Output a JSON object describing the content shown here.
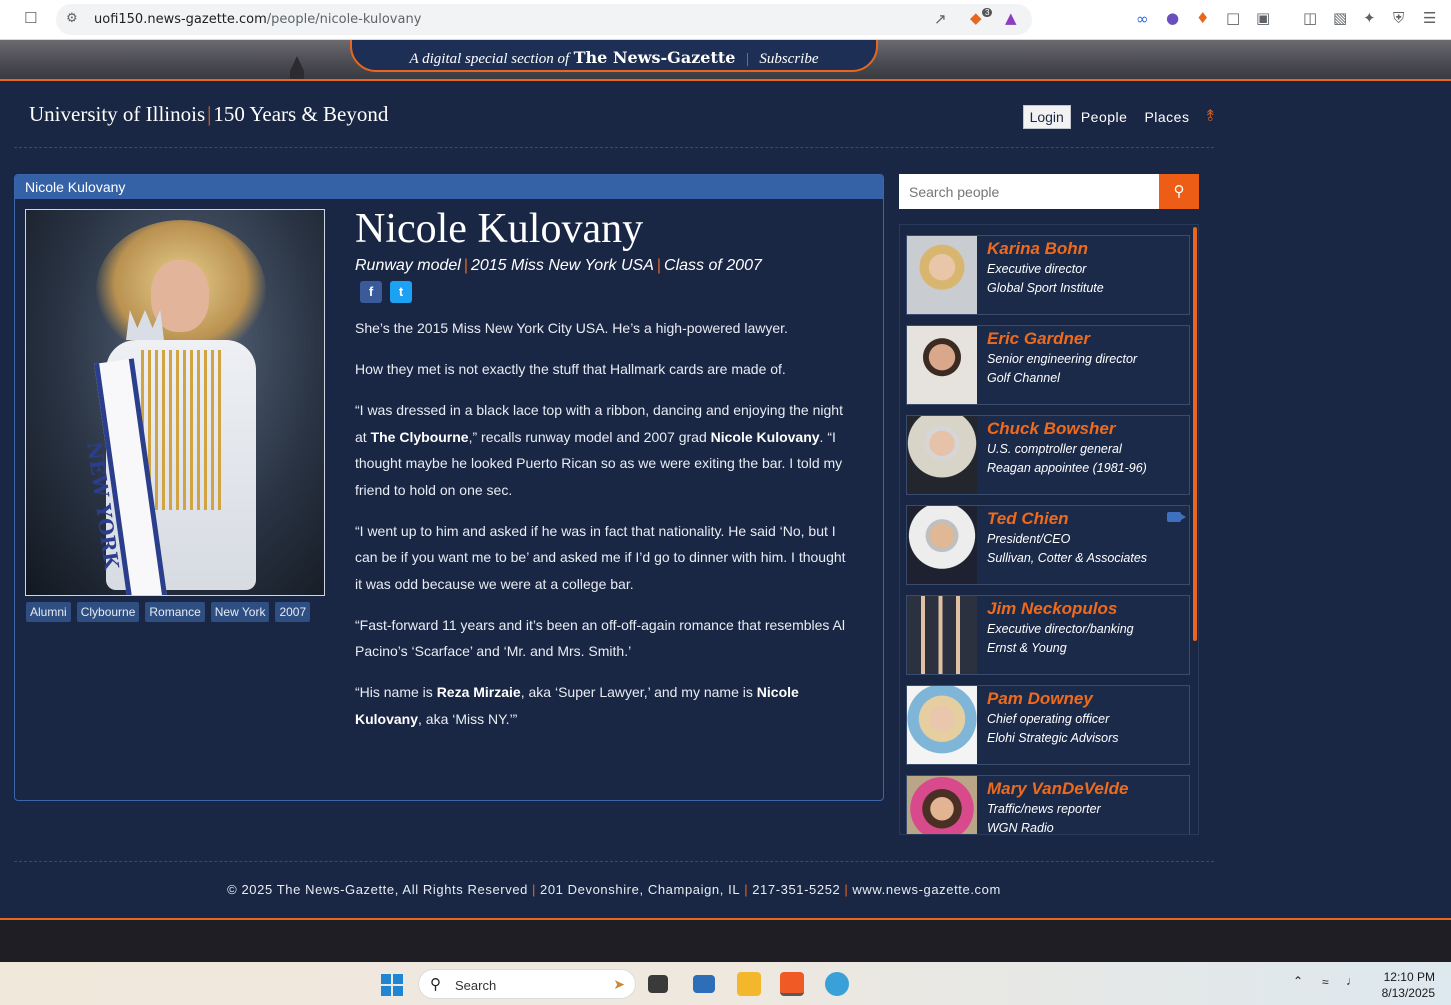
{
  "browser": {
    "url_host": "uofi150.news-gazette.com",
    "url_path": "/people/nicole-kulovany",
    "shields_badge": "3"
  },
  "banner": {
    "prefix": "A digital special section of",
    "paper": "The News-Gazette",
    "subscribe": "Subscribe"
  },
  "header": {
    "title_left": "University of Illinois",
    "title_right": "150 Years & Beyond",
    "nav": {
      "login": "Login",
      "people": "People",
      "places": "Places"
    }
  },
  "panel": {
    "heading": "Nicole Kulovany",
    "name": "Nicole Kulovany",
    "subtitle": [
      "Runway model",
      "2015 Miss New York USA",
      "Class of 2007"
    ],
    "social": {
      "facebook": "f",
      "twitter": "t"
    },
    "sash_text": "NEW YORK",
    "tags": [
      "Alumni",
      "Clybourne",
      "Romance",
      "New York",
      "2007"
    ],
    "article": {
      "p1": "She’s the 2015 Miss New York City USA. He’s a high-powered lawyer.",
      "p2": "How they met is not exactly the stuff that Hallmark cards are made of.",
      "p3a": "“I was dressed in a black lace top with a ribbon, dancing and enjoying the night at ",
      "p3b": "The Clybourne",
      "p3c": ",” recalls runway model and 2007 grad ",
      "p3d": "Nicole Kulovany",
      "p3e": ". “I thought maybe he looked Puerto Rican so as we were exiting the bar. I told my friend to hold on one sec.",
      "p4": "“I went up to him and asked if he was in fact that nationality. He said ‘No, but I can be if you want me to be’ and asked me if I’d go to dinner with him. I thought it was odd because we were at a college bar.",
      "p5": "“Fast-forward 11 years and it’s been an off-off-again romance that resembles Al Pacino’s ‘Scarface’ and ‘Mr. and Mrs. Smith.’",
      "p6a": "“His name is ",
      "p6b": "Reza Mirzaie",
      "p6c": ", aka ‘Super Lawyer,’ and my name is ",
      "p6d": "Nicole Kulovany",
      "p6e": ", aka ‘Miss NY.’”"
    }
  },
  "search": {
    "placeholder": "Search people"
  },
  "people": [
    {
      "name": "Karina Bohn",
      "role": "Executive director",
      "org": "Global Sport Institute"
    },
    {
      "name": "Eric Gardner",
      "role": "Senior engineering director",
      "org": "Golf Channel"
    },
    {
      "name": "Chuck Bowsher",
      "role": "U.S. comptroller general",
      "org": "Reagan appointee (1981-96)"
    },
    {
      "name": "Ted Chien",
      "role": "President/CEO",
      "org": "Sullivan, Cotter & Associates"
    },
    {
      "name": "Jim Neckopulos",
      "role": "Executive director/banking",
      "org": "Ernst & Young"
    },
    {
      "name": "Pam Downey",
      "role": "Chief operating officer",
      "org": "Elohi Strategic Advisors"
    },
    {
      "name": "Mary VanDeVelde",
      "role": "Traffic/news reporter",
      "org": "WGN Radio"
    }
  ],
  "footer": {
    "copyright": "© 2025 The News-Gazette, All Rights Reserved",
    "address": "201 Devonshire, Champaign, IL",
    "phone": "217-351-5252",
    "site": "www.news-gazette.com"
  },
  "taskbar": {
    "search_label": "Search",
    "time": "12:10 PM",
    "date": "8/13/2025"
  },
  "colors": {
    "background": "#1a2744",
    "accent": "#e8661e",
    "panel_header": "#3561a6"
  }
}
